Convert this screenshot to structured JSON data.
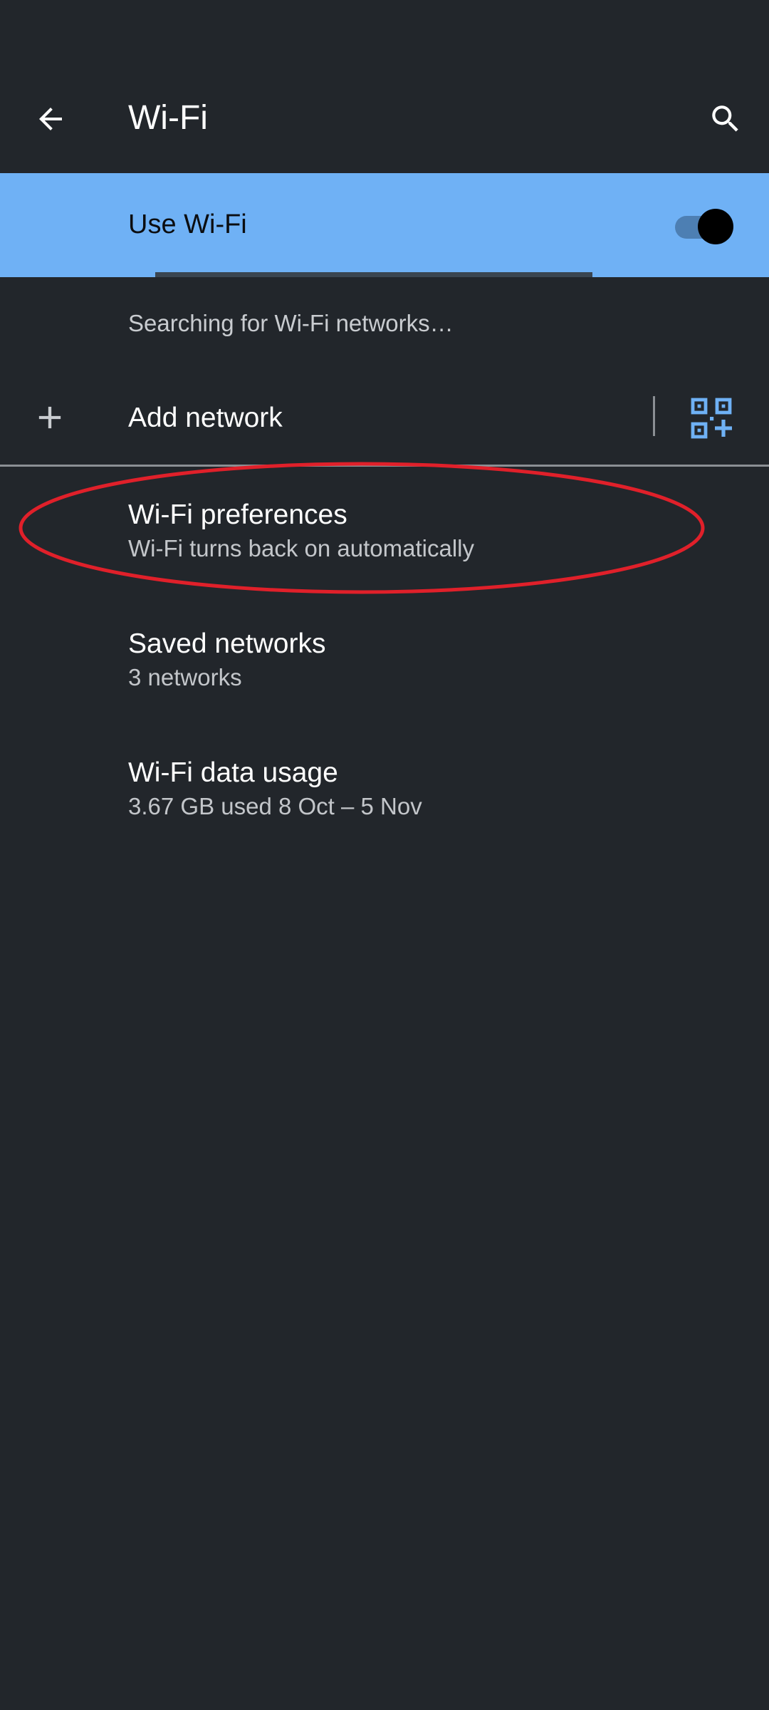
{
  "header": {
    "title": "Wi-Fi",
    "back_icon": "arrow-back-icon",
    "search_icon": "search-icon"
  },
  "use_wifi": {
    "label": "Use Wi-Fi",
    "enabled": true
  },
  "status": {
    "text": "Searching for Wi-Fi networks…"
  },
  "add_network": {
    "label": "Add network",
    "add_icon": "plus-icon",
    "qr_icon": "qr-code-scanner-icon"
  },
  "preferences": [
    {
      "title": "Wi-Fi preferences",
      "subtitle": "Wi-Fi turns back on automatically"
    },
    {
      "title": "Saved networks",
      "subtitle": "3 networks"
    },
    {
      "title": "Wi-Fi data usage",
      "subtitle": "3.67 GB used 8 Oct – 5 Nov"
    }
  ],
  "colors": {
    "background": "#22262b",
    "toggle_banner": "#6fb1f5",
    "accent": "#6fb1f5",
    "annotation": "#e0202a"
  }
}
